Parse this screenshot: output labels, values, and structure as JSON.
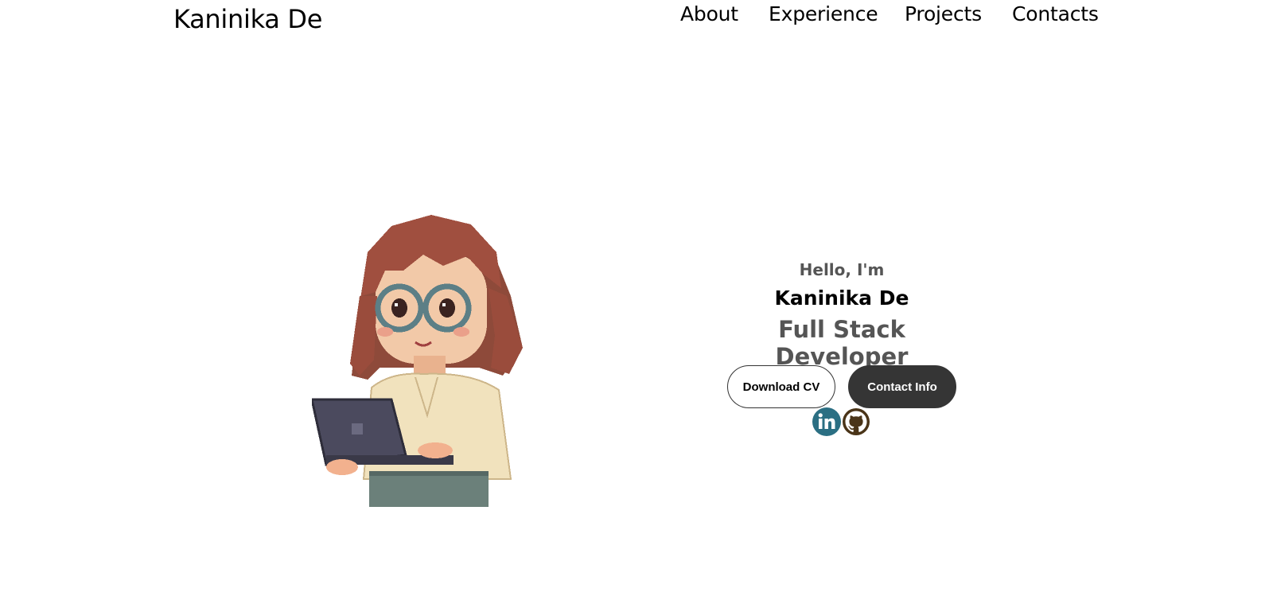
{
  "header": {
    "logo": "Kaninika De",
    "nav": {
      "about": "About",
      "experience": "Experience",
      "projects": "Projects",
      "contacts": "Contacts"
    }
  },
  "hero": {
    "greeting": "Hello, I'm",
    "name": "Kaninika De",
    "role": "Full Stack Developer",
    "buttons": {
      "download_cv": "Download CV",
      "contact_info": "Contact Info"
    },
    "social": {
      "linkedin_icon": "linkedin-icon",
      "github_icon": "github-icon"
    }
  },
  "colors": {
    "linkedin_bg": "#2b6f83",
    "github_fg": "#4a3418",
    "contact_btn_bg": "#353535",
    "role_text": "#555555"
  }
}
